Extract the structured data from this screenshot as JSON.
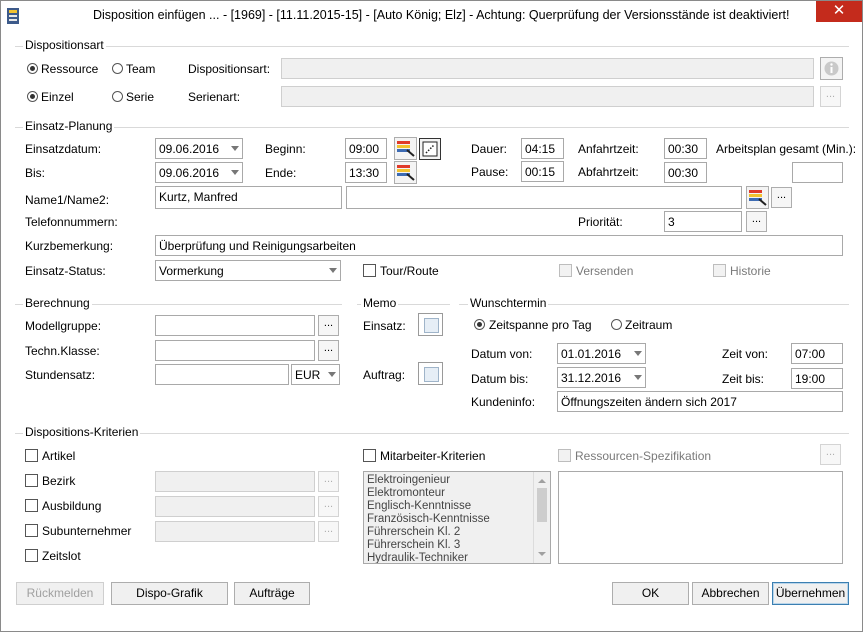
{
  "window": {
    "title": "Disposition einfügen ... - [1969] - [11.11.2015-15] - [Auto König; Elz] - Achtung: Querprüfung der Versionsstände ist deaktiviert!",
    "close_glyph": "✕"
  },
  "dispositionsart": {
    "group_label": "Dispositionsart",
    "radio_ressource": "Ressource",
    "radio_team": "Team",
    "radio_einzel": "Einzel",
    "radio_serie": "Serie",
    "dispositionsart_label": "Dispositionsart:",
    "serienart_label": "Serienart:",
    "more": "..."
  },
  "planung": {
    "group_label": "Einsatz-Planung",
    "einsatzdatum_label": "Einsatzdatum:",
    "einsatzdatum": "09.06.2016",
    "bis_label": "Bis:",
    "bis": "09.06.2016",
    "beginn_label": "Beginn:",
    "beginn": "09:00",
    "ende_label": "Ende:",
    "ende": "13:30",
    "dauer_label": "Dauer:",
    "dauer": "04:15",
    "pause_label": "Pause:",
    "pause": "00:15",
    "anfahrt_label": "Anfahrtzeit:",
    "anfahrt": "00:30",
    "abfahrt_label": "Abfahrtzeit:",
    "abfahrt": "00:30",
    "arbeitsplan_label": "Arbeitsplan gesamt (Min.):",
    "arbeitsplan": "",
    "name_label": "Name1/Name2:",
    "name1": "Kurtz, Manfred",
    "name2": "",
    "telefon_label": "Telefonnummern:",
    "prioritaet_label": "Priorität:",
    "prioritaet": "3",
    "kurzbemerkung_label": "Kurzbemerkung:",
    "kurzbemerkung": "Überprüfung und Reinigungsarbeiten",
    "status_label": "Einsatz-Status:",
    "status": "Vormerkung",
    "tour_label": "Tour/Route",
    "versenden_label": "Versenden",
    "historie_label": "Historie",
    "more": "..."
  },
  "berechnung": {
    "group_label": "Berechnung",
    "modellgruppe_label": "Modellgruppe:",
    "techn_label": "Techn.Klasse:",
    "stundensatz_label": "Stundensatz:",
    "waehrung": "EUR",
    "more": "..."
  },
  "memo": {
    "group_label": "Memo",
    "einsatz_label": "Einsatz:",
    "auftrag_label": "Auftrag:"
  },
  "wunschtermin": {
    "group_label": "Wunschtermin",
    "radio_zeitspanne": "Zeitspanne pro Tag",
    "radio_zeitraum": "Zeitraum",
    "datum_von_label": "Datum von:",
    "datum_von": "01.01.2016",
    "datum_bis_label": "Datum bis:",
    "datum_bis": "31.12.2016",
    "zeit_von_label": "Zeit von:",
    "zeit_von": "07:00",
    "zeit_bis_label": "Zeit bis:",
    "zeit_bis": "19:00",
    "kundeninfo_label": "Kundeninfo:",
    "kundeninfo": "Öffnungszeiten ändern sich 2017"
  },
  "kriterien": {
    "group_label": "Dispositions-Kriterien",
    "artikel": "Artikel",
    "bezirk": "Bezirk",
    "ausbildung": "Ausbildung",
    "subunternehmer": "Subunternehmer",
    "zeitslot": "Zeitslot",
    "mitarbeiter": "Mitarbeiter-Kriterien",
    "ressourcen": "Ressourcen-Spezifikation",
    "more": "...",
    "mitarbeiter_list": [
      "Elektroingenieur",
      "Elektromonteur",
      "Englisch-Kenntnisse",
      "Französisch-Kenntnisse",
      "Führerschein Kl. 2",
      "Führerschein Kl. 3",
      "Hydraulik-Techniker"
    ]
  },
  "buttons": {
    "rueckmelden": "Rückmelden",
    "dispo_grafik": "Dispo-Grafik",
    "auftraege": "Aufträge",
    "ok": "OK",
    "abbrechen": "Abbrechen",
    "uebernehmen": "Übernehmen"
  }
}
